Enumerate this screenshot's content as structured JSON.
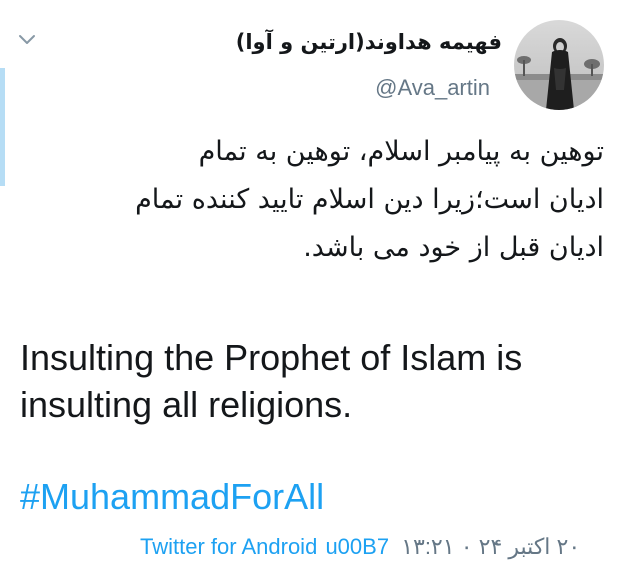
{
  "tweet": {
    "display_name": "فهیمه هداوند(ارتین و آوا)",
    "handle": "@Ava_artin",
    "text_fa": [
      "توهین به پیامبر  اسلام، توهین به تمام",
      "ادیان است؛زیرا دین اسلام تایید کننده تمام",
      "ادیان قبل از خود می باشد."
    ],
    "text_en": [
      "Insulting the Prophet of Islam is",
      "insulting all religions."
    ],
    "hashtag": "#MuhammadForAll",
    "source": "Twitter for Android",
    "separator": "u00B7",
    "date": "۲۰ اکتبر ۲۴ ۰ ۱۳:۲۱",
    "avatar_icon": "user-avatar-photo",
    "menu_icon": "chevron-down-icon",
    "colors": {
      "link": "#1da1f2",
      "text": "#14171a",
      "secondary": "#657786",
      "accent_bar": "#b6ddf5"
    }
  }
}
